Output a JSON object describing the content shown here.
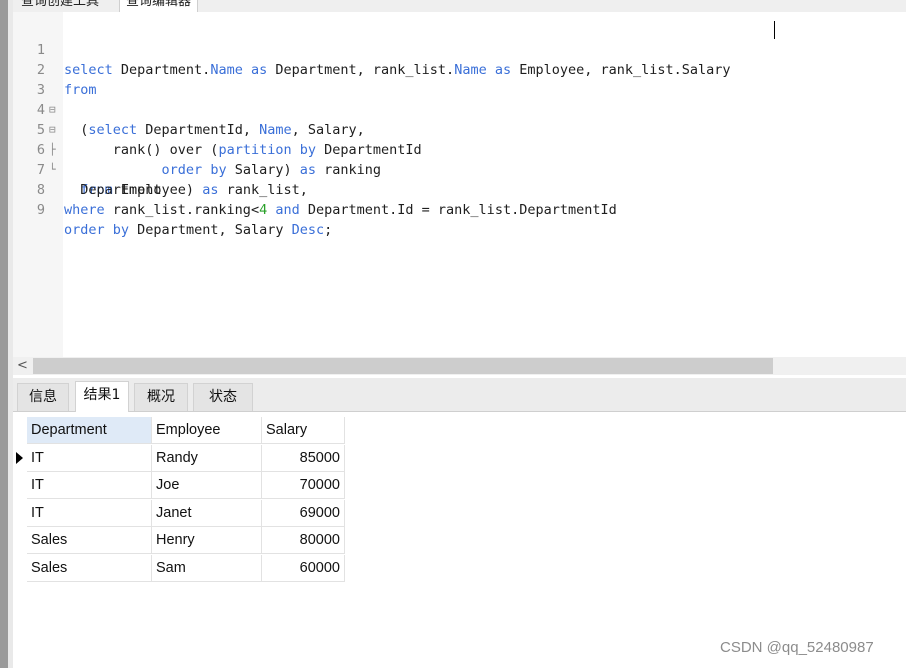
{
  "top_tabs": [
    "查询创建工具",
    "查询编辑器"
  ],
  "editor": {
    "lines": [
      {
        "n": "1",
        "fold": ""
      },
      {
        "n": "2",
        "fold": ""
      },
      {
        "n": "3",
        "fold": "⊟"
      },
      {
        "n": "4",
        "fold": "⊟"
      },
      {
        "n": "5",
        "fold": "├"
      },
      {
        "n": "6",
        "fold": "└"
      },
      {
        "n": "7",
        "fold": ""
      },
      {
        "n": "8",
        "fold": ""
      },
      {
        "n": "9",
        "fold": ""
      }
    ],
    "code": {
      "l1": [
        "select",
        " Department.",
        "Name",
        " ",
        "as",
        " Department, rank_list.",
        "Name",
        " ",
        "as",
        " Employee, rank_list.Salary"
      ],
      "l2": [
        "from"
      ],
      "l3": [
        "  (",
        "select",
        " DepartmentId, ",
        "Name",
        ", Salary,"
      ],
      "l4": [
        "      rank() over (",
        "partition",
        " ",
        "by",
        " DepartmentId"
      ],
      "l5": [
        "            ",
        "order",
        " ",
        "by",
        " Salary) ",
        "as",
        " ranking"
      ],
      "l6": [
        "  ",
        "from",
        " Employee) ",
        "as",
        " rank_list,"
      ],
      "l7": [
        "  Department"
      ],
      "l8": [
        "where",
        " rank_list.ranking<",
        "4",
        " ",
        "and",
        " Department.Id = rank_list.DepartmentId"
      ],
      "l9": [
        "order",
        " ",
        "by",
        " Department, Salary ",
        "Desc",
        ";"
      ]
    }
  },
  "scroll_left": "<",
  "result_tabs": [
    "信息",
    "结果1",
    "概况",
    "状态"
  ],
  "active_result_tab": "结果1",
  "table": {
    "columns": [
      "Department",
      "Employee",
      "Salary"
    ],
    "rows": [
      [
        "IT",
        "Randy",
        "85000"
      ],
      [
        "IT",
        "Joe",
        "70000"
      ],
      [
        "IT",
        "Janet",
        "69000"
      ],
      [
        "Sales",
        "Henry",
        "80000"
      ],
      [
        "Sales",
        "Sam",
        "60000"
      ]
    ]
  },
  "watermark": "CSDN @qq_52480987",
  "colors": {
    "keyword": "#3a6fd8",
    "number": "#2aa02a",
    "header_selected": "#dfeaf7"
  }
}
